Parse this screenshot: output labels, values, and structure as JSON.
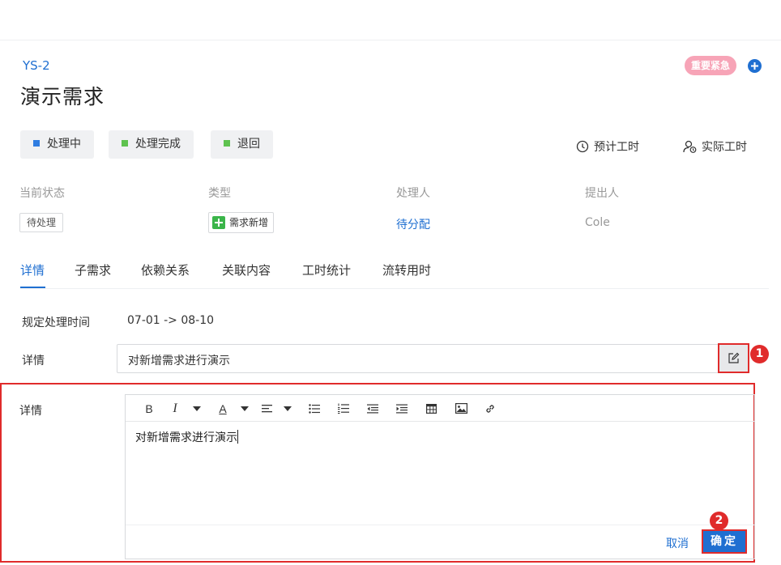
{
  "header": {
    "issue_id": "YS-2",
    "title": "演示需求",
    "priority": "重要紧急"
  },
  "status_buttons": [
    {
      "label": "处理中",
      "color": "#2f7de1"
    },
    {
      "label": "处理完成",
      "color": "#5ec24f"
    },
    {
      "label": "退回",
      "color": "#5ec24f"
    }
  ],
  "time_links": {
    "estimated": "预计工时",
    "actual": "实际工时"
  },
  "fields": {
    "current_status": {
      "label": "当前状态",
      "value": "待处理"
    },
    "type": {
      "label": "类型",
      "value": "需求新增"
    },
    "assignee": {
      "label": "处理人",
      "value": "待分配"
    },
    "reporter": {
      "label": "提出人",
      "value": "Cole"
    }
  },
  "tabs": [
    {
      "label": "详情",
      "active": true
    },
    {
      "label": "子需求"
    },
    {
      "label": "依赖关系"
    },
    {
      "label": "关联内容"
    },
    {
      "label": "工时统计"
    },
    {
      "label": "流转用时"
    }
  ],
  "schedule": {
    "label": "规定处理时间",
    "value": "07-01 -> 08-10"
  },
  "detail": {
    "label": "详情",
    "value": "对新增需求进行演示"
  },
  "callouts": [
    "1",
    "2"
  ],
  "editor": {
    "label": "详情",
    "toolbar": {
      "bold": "B",
      "italic": "I",
      "font_color": "A"
    },
    "content": "对新增需求进行演示",
    "cancel_label": "取消",
    "confirm_label": "确定"
  },
  "colors": {
    "accent": "#1f6fd1",
    "highlight": "#e02b2b",
    "priority_badge": "#f7a4b7"
  }
}
